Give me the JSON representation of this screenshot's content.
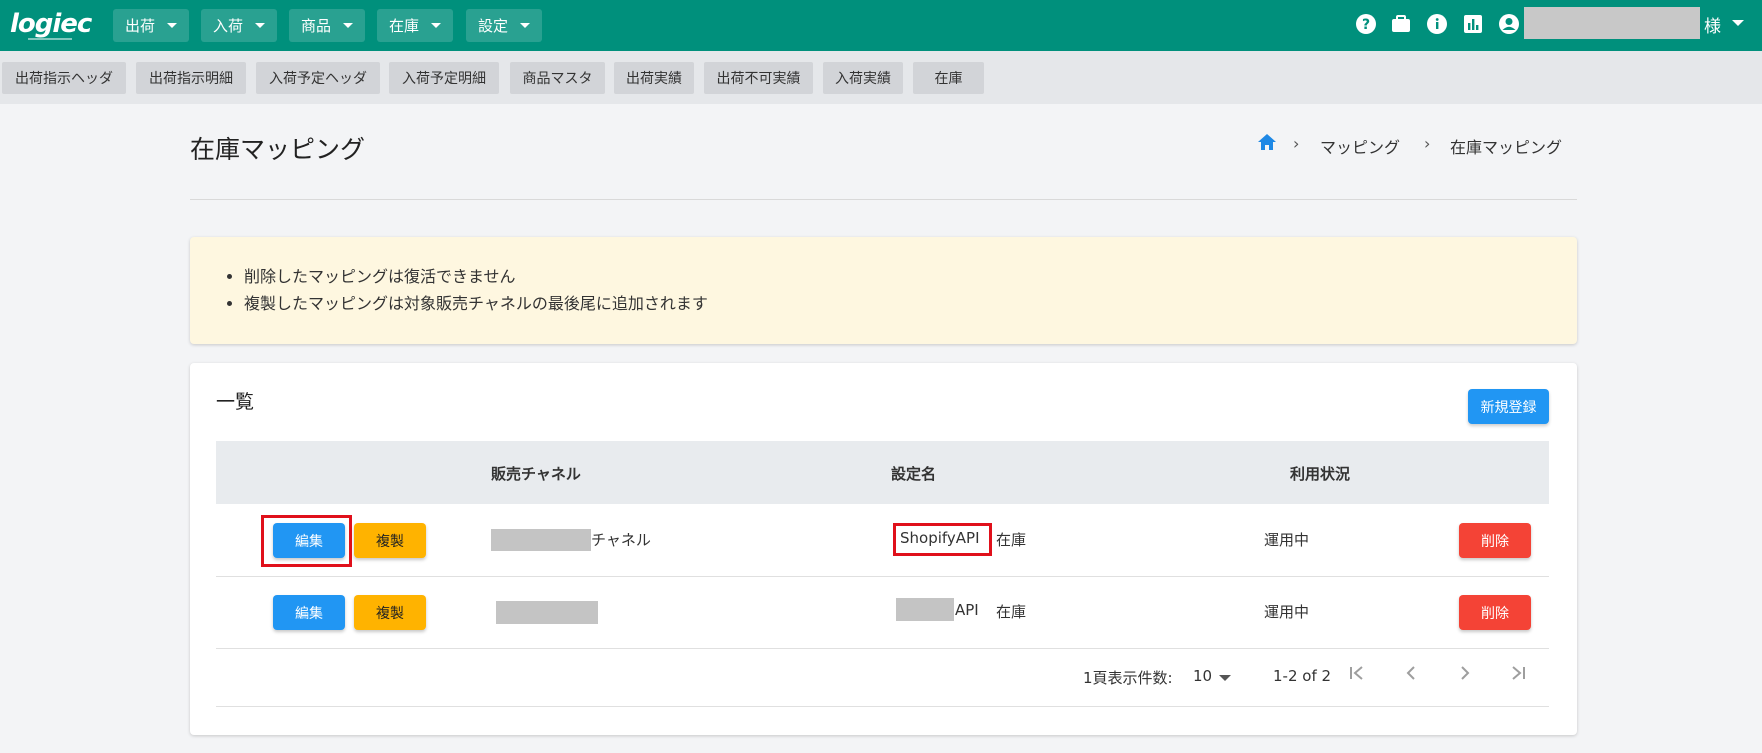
{
  "header": {
    "logo": "logiec",
    "menus": [
      {
        "label": "出荷"
      },
      {
        "label": "入荷"
      },
      {
        "label": "商品"
      },
      {
        "label": "在庫"
      },
      {
        "label": "設定"
      }
    ],
    "user_suffix": "様",
    "icons": [
      "help-icon",
      "briefcase-icon",
      "info-icon",
      "chart-icon",
      "account-icon"
    ]
  },
  "subnav": {
    "tabs": [
      {
        "label": "出荷指示ヘッダ"
      },
      {
        "label": "出荷指示明細"
      },
      {
        "label": "入荷予定ヘッダ"
      },
      {
        "label": "入荷予定明細"
      },
      {
        "label": "商品マスタ"
      },
      {
        "label": "出荷実績"
      },
      {
        "label": "出荷不可実績"
      },
      {
        "label": "入荷実績"
      },
      {
        "label": "在庫"
      }
    ]
  },
  "page": {
    "title": "在庫マッピング",
    "breadcrumb": [
      "マッピング",
      "在庫マッピング"
    ]
  },
  "notice": {
    "items": [
      "削除したマッピングは復活できません",
      "複製したマッピングは対象販売チャネルの最後尾に追加されます"
    ]
  },
  "list": {
    "title": "一覧",
    "new_button": "新規登録",
    "columns": {
      "channel": "販売チャネル",
      "setting": "設定名",
      "status": "利用状況"
    },
    "rows": [
      {
        "edit": "編集",
        "copy": "複製",
        "channel_suffix": "チャネル",
        "setting_name": "ShopifyAPI",
        "setting_suffix": "在庫",
        "status": "運用中",
        "delete": "削除"
      },
      {
        "edit": "編集",
        "copy": "複製",
        "channel_suffix": "",
        "setting_name": "API",
        "setting_suffix": "在庫",
        "status": "運用中",
        "delete": "削除"
      }
    ],
    "pagination": {
      "per_page_label": "1頁表示件数:",
      "per_page_value": "10",
      "range": "1-2 of 2"
    }
  },
  "colors": {
    "header": "#00907c",
    "primary": "#2196f3",
    "warning": "#ffb300",
    "danger": "#f44336",
    "highlight": "#e0101b"
  }
}
